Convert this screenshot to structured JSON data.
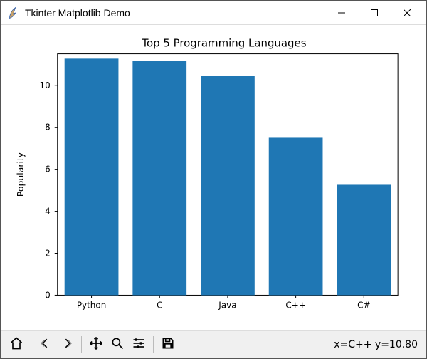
{
  "window": {
    "title": "Tkinter Matplotlib Demo",
    "app_icon": "tk-feather-icon"
  },
  "chart_data": {
    "type": "bar",
    "title": "Top 5 Programming Languages",
    "categories": [
      "Python",
      "C",
      "Java",
      "C++",
      "C#"
    ],
    "values": [
      11.27,
      11.16,
      10.46,
      7.5,
      5.26
    ],
    "xlabel": "",
    "ylabel": "Popularity",
    "ylim": [
      0,
      11.5
    ],
    "yticks": [
      0,
      2,
      4,
      6,
      8,
      10
    ],
    "bar_color": "#1f77b4"
  },
  "toolbar": {
    "home": "home-icon",
    "back": "back-icon",
    "forward": "forward-icon",
    "pan": "pan-icon",
    "zoom": "zoom-icon",
    "configure": "configure-icon",
    "save": "save-icon",
    "coord_readout": "x=C++ y=10.80"
  }
}
